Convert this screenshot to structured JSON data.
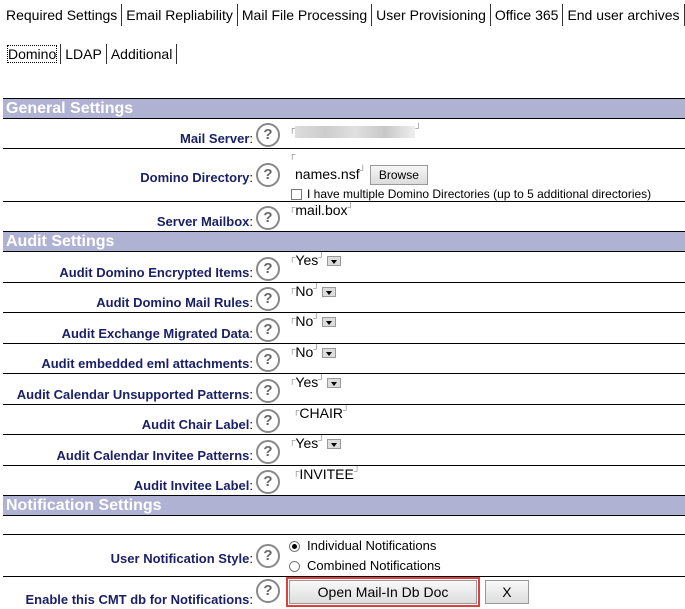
{
  "tabs": [
    "Required Settings",
    "Email Repliability",
    "Mail File Processing",
    "User Provisioning",
    "Office 365",
    "End user archives"
  ],
  "subtabs": [
    "Domino",
    "LDAP",
    "Additional"
  ],
  "sections": {
    "general": "General Settings",
    "audit": "Audit Settings",
    "notification": "Notification Settings"
  },
  "general": {
    "mail_server_label": "Mail Server",
    "domino_directory_label": "Domino Directory",
    "domino_directory_value": "names.nsf",
    "browse": "Browse",
    "multiple_dirs": "I have multiple Domino Directories (up to 5 additional directories)",
    "server_mailbox_label": "Server Mailbox",
    "server_mailbox_value": "mail.box"
  },
  "audit": [
    {
      "label": "Audit Domino Encrypted Items",
      "value": "Yes",
      "select": true
    },
    {
      "label": "Audit Domino Mail Rules",
      "value": "No",
      "select": true
    },
    {
      "label": "Audit Exchange Migrated Data",
      "value": "No",
      "select": true
    },
    {
      "label": "Audit embedded eml attachments",
      "value": "No",
      "select": true
    },
    {
      "label": "Audit Calendar Unsupported Patterns",
      "value": "Yes",
      "select": true
    },
    {
      "label": "Audit Chair Label",
      "value": "CHAIR",
      "select": false
    },
    {
      "label": "Audit Calendar Invitee Patterns",
      "value": "Yes",
      "select": true
    },
    {
      "label": "Audit Invitee Label",
      "value": "INVITEE",
      "select": false
    }
  ],
  "notification": {
    "style_label": "User Notification Style",
    "individual": "Individual Notifications",
    "combined": "Combined Notifications",
    "enable_label": "Enable this CMT db for Notifications",
    "open_btn": "Open Mail-In Db Doc",
    "x_btn": "X"
  },
  "help": "?",
  "colon": ":"
}
